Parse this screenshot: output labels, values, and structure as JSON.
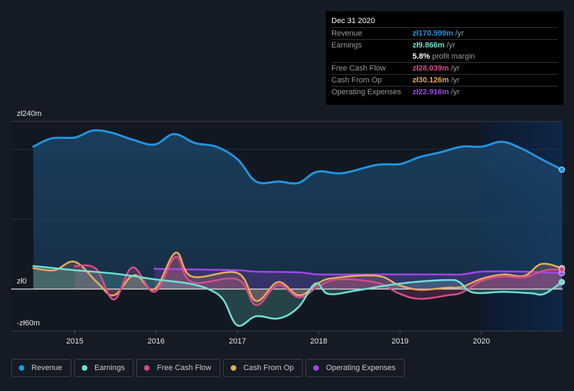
{
  "tooltip": {
    "date": "Dec 31 2020",
    "rows": [
      {
        "label": "Revenue",
        "value": "zł170.599m",
        "unit": " /yr",
        "color": "#2394df"
      },
      {
        "label": "Earnings",
        "value": "zł9.866m",
        "unit": " /yr",
        "color": "#6ee0d4"
      },
      {
        "label": "",
        "value": "5.8%",
        "unit": " profit margin",
        "color": "#ffffff"
      },
      {
        "label": "Free Cash Flow",
        "value": "zł28.039m",
        "unit": " /yr",
        "color": "#d64b8c"
      },
      {
        "label": "Cash From Op",
        "value": "zł30.126m",
        "unit": " /yr",
        "color": "#e8a95c"
      },
      {
        "label": "Operating Expenses",
        "value": "zł22.916m",
        "unit": " /yr",
        "color": "#a146e6"
      }
    ]
  },
  "legend": [
    {
      "label": "Revenue",
      "color": "#2394df"
    },
    {
      "label": "Earnings",
      "color": "#6ee0d4"
    },
    {
      "label": "Free Cash Flow",
      "color": "#d64b8c"
    },
    {
      "label": "Cash From Op",
      "color": "#e8a95c"
    },
    {
      "label": "Operating Expenses",
      "color": "#a146e6"
    }
  ],
  "chart_data": {
    "type": "line",
    "title": "",
    "xlabel": "",
    "ylabel": "",
    "currency": "zł",
    "ylim": [
      -60,
      240
    ],
    "xlim": [
      2014.0,
      2021.0
    ],
    "y_tick_labels": [
      {
        "value": 240,
        "label": "zł240m"
      },
      {
        "value": 0,
        "label": "zł0"
      },
      {
        "value": -60,
        "label": "-zł60m"
      }
    ],
    "gridlines": [
      240,
      200,
      100,
      0
    ],
    "x_ticks": [
      2015,
      2016,
      2017,
      2018,
      2019,
      2020
    ],
    "x_tick_labels": [
      "2015",
      "2016",
      "2017",
      "2018",
      "2019",
      "2020"
    ],
    "highlight_range": [
      2020.0,
      2021.0
    ],
    "legend_position": "bottom",
    "series": [
      {
        "name": "Revenue",
        "color": "#2394df",
        "fill": true,
        "x": [
          2014.49,
          2014.72,
          2015.0,
          2015.22,
          2015.45,
          2015.71,
          2015.98,
          2016.22,
          2016.48,
          2016.74,
          2017.0,
          2017.23,
          2017.51,
          2017.75,
          2017.98,
          2018.29,
          2018.72,
          2019.0,
          2019.24,
          2019.5,
          2019.76,
          2020.01,
          2020.25,
          2020.48,
          2020.74,
          2020.99
        ],
        "values": [
          204,
          216,
          217,
          227,
          224,
          214,
          207,
          222,
          209,
          204,
          186,
          154,
          154,
          152,
          168,
          166,
          178,
          179,
          189,
          196,
          204,
          204,
          211,
          202,
          186,
          171
        ]
      },
      {
        "name": "Earnings",
        "color": "#6ee0d4",
        "fill": true,
        "x": [
          2014.49,
          2015.0,
          2015.5,
          2015.98,
          2016.4,
          2016.66,
          2016.83,
          2017.0,
          2017.23,
          2017.51,
          2017.75,
          2017.96,
          2018.12,
          2018.47,
          2018.82,
          2019.17,
          2019.6,
          2019.73,
          2019.9,
          2020.27,
          2020.61,
          2020.77,
          2020.99
        ],
        "values": [
          33,
          27,
          22,
          14,
          8,
          -1,
          -16,
          -52,
          -39,
          -42,
          -26,
          8,
          -7,
          -2,
          5,
          10,
          13,
          10,
          -5,
          -4,
          -6,
          -7,
          10
        ]
      },
      {
        "name": "Free Cash Flow",
        "color": "#d64b8c",
        "fill": true,
        "x": [
          2015.0,
          2015.26,
          2015.48,
          2015.71,
          2015.98,
          2016.24,
          2016.44,
          2017.0,
          2017.23,
          2017.5,
          2017.76,
          2018.0,
          2018.25,
          2018.72,
          2018.98,
          2019.24,
          2019.58,
          2019.76,
          2020.01,
          2020.27,
          2020.53,
          2020.79,
          2020.99
        ],
        "values": [
          33,
          29,
          -15,
          31,
          -4,
          46,
          10,
          14,
          -23,
          6,
          -12,
          4,
          14,
          9,
          -6,
          -14,
          -9,
          -5,
          12,
          18,
          17,
          27,
          28
        ]
      },
      {
        "name": "Cash From Op",
        "color": "#e8a95c",
        "fill": true,
        "x": [
          2014.49,
          2014.75,
          2015.0,
          2015.28,
          2015.48,
          2015.73,
          2015.98,
          2016.24,
          2016.44,
          2017.0,
          2017.23,
          2017.5,
          2017.76,
          2018.0,
          2018.2,
          2018.72,
          2018.98,
          2019.24,
          2019.58,
          2019.76,
          2020.01,
          2020.27,
          2020.53,
          2020.74,
          2020.99
        ],
        "values": [
          30,
          27,
          39,
          9,
          -9,
          20,
          0,
          52,
          18,
          23,
          -17,
          10,
          -9,
          9,
          16,
          19,
          6,
          -1,
          2,
          3,
          15,
          21,
          19,
          36,
          30
        ]
      },
      {
        "name": "Operating Expenses",
        "color": "#a146e6",
        "fill": true,
        "x": [
          2015.98,
          2016.5,
          2017.0,
          2017.23,
          2017.75,
          2018.0,
          2018.5,
          2019.0,
          2019.5,
          2019.76,
          2020.01,
          2020.5,
          2020.99
        ],
        "values": [
          29,
          28,
          27,
          25,
          24,
          21,
          21,
          21,
          21,
          21,
          25,
          25,
          23
        ]
      }
    ]
  }
}
